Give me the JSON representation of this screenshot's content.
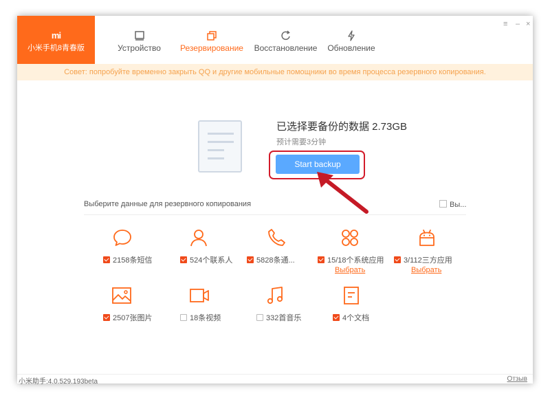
{
  "app": {
    "logo": "mi",
    "name": "小米手机8青春版",
    "accent_color": "#ff6a1b"
  },
  "nav": {
    "tabs": [
      {
        "label": "Устройство",
        "icon": "device-icon"
      },
      {
        "label": "Резервирование",
        "icon": "backup-icon",
        "active": true
      },
      {
        "label": "Восстановление",
        "icon": "restore-icon"
      },
      {
        "label": "Обновление",
        "icon": "update-icon"
      }
    ]
  },
  "window_controls": {
    "menu": "≡",
    "minimize": "–",
    "close": "×"
  },
  "tip": {
    "text": "Совет: попробуйте временно закрыть QQ и другие мобильные помощники во время процесса резервного копирования."
  },
  "summary": {
    "title": "已选择要备份的数据 2.73GB",
    "subtitle": "预计需要3分钟"
  },
  "actions": {
    "start_backup": "Start backup"
  },
  "selection": {
    "label": "Выберите данные для резервного копирования",
    "select_all": "Вы..."
  },
  "items": [
    {
      "icon": "message-icon",
      "label": "2158条短信",
      "checked": true
    },
    {
      "icon": "contacts-icon",
      "label": "524个联系人",
      "checked": true
    },
    {
      "icon": "phone-icon",
      "label": "5828条通...",
      "checked": true
    },
    {
      "icon": "system-apps-icon",
      "label": "15/18个系统应用",
      "checked": true,
      "link": "Выбрать"
    },
    {
      "icon": "android-icon",
      "label": "3/112三方应用",
      "checked": true,
      "link": "Выбрать"
    },
    {
      "icon": "image-icon",
      "label": "2507张图片",
      "checked": true
    },
    {
      "icon": "video-icon",
      "label": "18条视频",
      "checked": false
    },
    {
      "icon": "music-icon",
      "label": "332首音乐",
      "checked": false
    },
    {
      "icon": "document-icon",
      "label": "4个文档",
      "checked": true
    }
  ],
  "footer": {
    "version": "小米助手:4.0.529.193beta",
    "feedback": "Отзыв"
  }
}
